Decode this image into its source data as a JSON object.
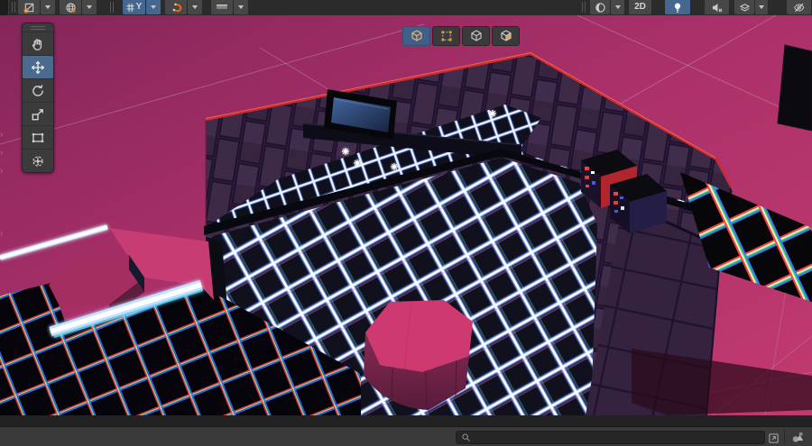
{
  "toolbar": {
    "tool_settings": {
      "handle_position_icon": "pivot-icon",
      "handle_rotation_icon": "globe-icon"
    },
    "grid_snap": {
      "axis_label": "Y",
      "snap_icon": "magnet-icon",
      "grid_visual_icon": "grid-ruler-icon"
    },
    "view_controls": {
      "shading_icon": "shaded-sphere-icon",
      "mode_2d_label": "2D",
      "lighting_icon": "lightbulb-icon",
      "lighting_active": true,
      "audio_icon": "audio-muted-icon",
      "effects_icon": "effects-layers-icon",
      "visibility_icon": "eye-hidden-icon"
    }
  },
  "edit_mode_bar": {
    "buttons": [
      {
        "id": "object-selection",
        "icon": "cube-wire-icon",
        "active": true
      },
      {
        "id": "vertex-selection",
        "icon": "vertex-rect-icon",
        "active": false
      },
      {
        "id": "edge-selection",
        "icon": "cube-edge-icon",
        "active": false
      },
      {
        "id": "face-selection",
        "icon": "cube-face-icon",
        "active": false
      }
    ]
  },
  "tools_panel": {
    "items": [
      {
        "id": "view-tool",
        "icon": "hand-icon",
        "active": false
      },
      {
        "id": "move-tool",
        "icon": "move-arrows-icon",
        "active": true
      },
      {
        "id": "rotate-tool",
        "icon": "rotate-icon",
        "active": false
      },
      {
        "id": "scale-tool",
        "icon": "scale-icon",
        "active": false
      },
      {
        "id": "rect-tool",
        "icon": "rect-icon",
        "active": false
      },
      {
        "id": "transform-tool",
        "icon": "transform-icon",
        "active": false
      }
    ]
  },
  "bottom_bar": {
    "search": {
      "value": "",
      "placeholder": "",
      "icon": "search-icon"
    },
    "icons": [
      "maximize-icon",
      "shapes-icon"
    ]
  },
  "scene": {
    "colors": {
      "ground_pink": "#b13570",
      "wall_purple": "#38263f",
      "rim_red": "#d92b2e",
      "neon_white": "#ffffff",
      "neon_blue_glow": "#7fb2ff",
      "active_blue": "#45678f",
      "accent_orange": "#e57724"
    },
    "objects": [
      "back-wall",
      "tv-screen",
      "wall-counter",
      "upper-floor-grid",
      "mid-wall",
      "main-floor-grid",
      "rgb-grid-floor",
      "left-platform",
      "neon-edge-strips",
      "pink-pillar",
      "red-shelf",
      "blue-shelf",
      "rooftop-rainbow-grid",
      "light-gizmos"
    ],
    "light_gizmo_count": 4
  }
}
